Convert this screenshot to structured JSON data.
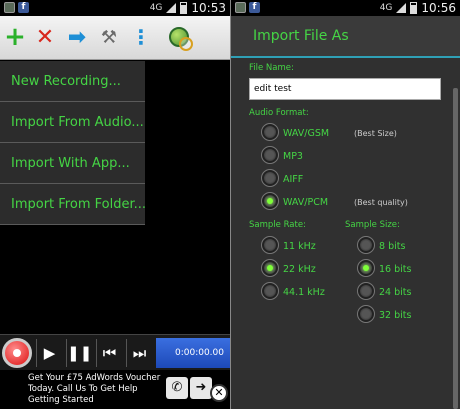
{
  "left": {
    "status_time": "10:53",
    "status_network": "4G",
    "toolbar_icons": [
      "plus-icon",
      "x-icon",
      "arrow-right-icon",
      "tools-icon",
      "overflow-icon",
      "globe-search-icon"
    ],
    "menu": [
      {
        "label": "New Recording..."
      },
      {
        "label": "Import From Audio..."
      },
      {
        "label": "Import With App..."
      },
      {
        "label": "Import From Folder..."
      }
    ],
    "player_time": "0:00:00.00",
    "ad": {
      "text": "Get Your £75 AdWords Voucher Today. Call Us To Get Help Getting Started"
    }
  },
  "right": {
    "status_time": "10:56",
    "status_network": "4G",
    "dialog_title": "Import File As",
    "file_name_label": "File Name:",
    "file_name_value": "edit test",
    "audio_format_label": "Audio Format:",
    "formats": [
      {
        "label": "WAV/GSM",
        "note": "(Best Size)",
        "selected": false
      },
      {
        "label": "MP3",
        "note": "",
        "selected": false
      },
      {
        "label": "AIFF",
        "note": "",
        "selected": false
      },
      {
        "label": "WAV/PCM",
        "note": "(Best quality)",
        "selected": true
      }
    ],
    "sample_rate_label": "Sample Rate:",
    "sample_rates": [
      {
        "label": "11 kHz",
        "selected": false
      },
      {
        "label": "22 kHz",
        "selected": true
      },
      {
        "label": "44.1 kHz",
        "selected": false
      }
    ],
    "sample_size_label": "Sample Size:",
    "sample_sizes": [
      {
        "label": "8 bits",
        "selected": false
      },
      {
        "label": "16 bits",
        "selected": true
      },
      {
        "label": "24 bits",
        "selected": false
      },
      {
        "label": "32 bits",
        "selected": false
      }
    ]
  },
  "colors": {
    "accent": "#45d545",
    "title_line": "#2fa0b6"
  }
}
